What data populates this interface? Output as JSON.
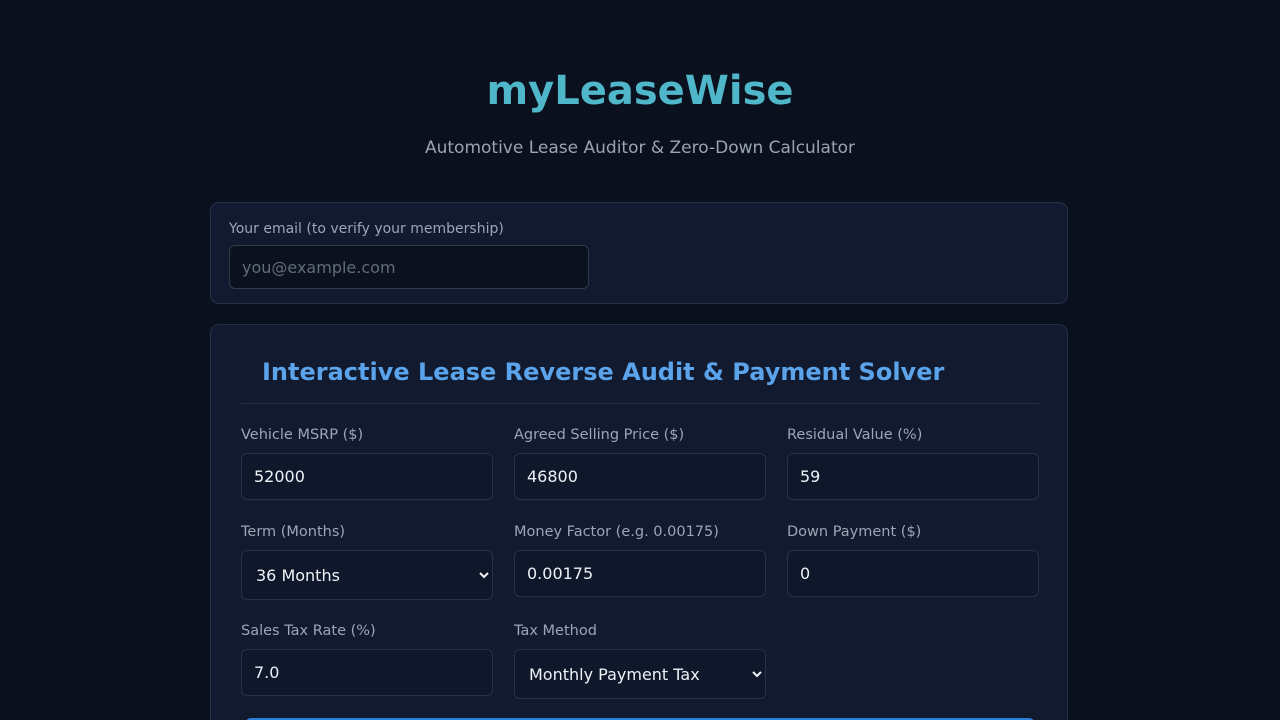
{
  "header": {
    "brand": "myLeaseWise",
    "tagline": "Automotive Lease Auditor & Zero-Down Calculator"
  },
  "membership": {
    "email_label": "Your email (to verify your membership)",
    "email_placeholder": "you@example.com",
    "email_value": ""
  },
  "audit": {
    "title": "Interactive Lease Reverse Audit & Payment Solver",
    "fields": {
      "msrp": {
        "label": "Vehicle MSRP ($)",
        "value": "52000"
      },
      "selling_price": {
        "label": "Agreed Selling Price ($)",
        "value": "46800"
      },
      "residual": {
        "label": "Residual Value (%)",
        "value": "59"
      },
      "term": {
        "label": "Term (Months)",
        "value": "36 Months",
        "options": [
          "36 Months"
        ]
      },
      "money_factor": {
        "label": "Money Factor (e.g. 0.00175)",
        "value": "0.00175"
      },
      "down_payment": {
        "label": "Down Payment ($)",
        "value": "0"
      },
      "sales_tax": {
        "label": "Sales Tax Rate (%)",
        "value": "7.0"
      },
      "tax_method": {
        "label": "Tax Method",
        "value": "Monthly Payment Tax",
        "options": [
          "Monthly Payment Tax"
        ]
      }
    }
  },
  "colors": {
    "background": "#0a101d",
    "card": "#111a2e",
    "brand": "#4fb7c9",
    "section_title": "#5ba3ea",
    "accent_button": "#2a7fd6"
  }
}
